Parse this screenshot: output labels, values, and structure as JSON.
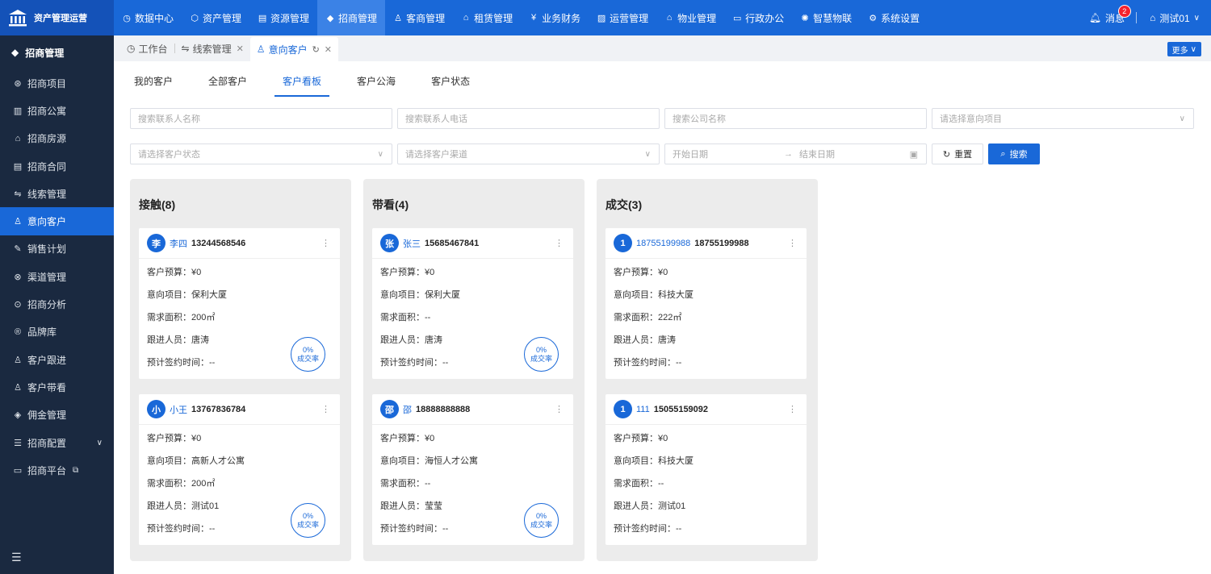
{
  "brand": {
    "title": "资产管理运营"
  },
  "nav": [
    {
      "label": "数据中心",
      "icon": "clock-icon",
      "glyph": "◷"
    },
    {
      "label": "资产管理",
      "icon": "cube-icon",
      "glyph": "⬡"
    },
    {
      "label": "资源管理",
      "icon": "building-icon",
      "glyph": "▤"
    },
    {
      "label": "招商管理",
      "icon": "tag-icon",
      "glyph": "◆"
    },
    {
      "label": "客商管理",
      "icon": "people-icon",
      "glyph": "♙"
    },
    {
      "label": "租赁管理",
      "icon": "house-icon",
      "glyph": "⌂"
    },
    {
      "label": "业务财务",
      "icon": "yen-icon",
      "glyph": "¥"
    },
    {
      "label": "运营管理",
      "icon": "chart-icon",
      "glyph": "▨"
    },
    {
      "label": "物业管理",
      "icon": "home-icon",
      "glyph": "⌂"
    },
    {
      "label": "行政办公",
      "icon": "monitor-icon",
      "glyph": "▭"
    },
    {
      "label": "智慧物联",
      "icon": "sun-icon",
      "glyph": "✺"
    },
    {
      "label": "系统设置",
      "icon": "gear-icon",
      "glyph": "⚙"
    }
  ],
  "header": {
    "messages": "消息",
    "message_count": "2",
    "user": "测试01"
  },
  "sidebar": {
    "title": "招商管理",
    "items": [
      {
        "label": "招商项目",
        "icon": "project-icon",
        "glyph": "⊛"
      },
      {
        "label": "招商公寓",
        "icon": "apartment-icon",
        "glyph": "▥"
      },
      {
        "label": "招商房源",
        "icon": "house-icon",
        "glyph": "⌂"
      },
      {
        "label": "招商合同",
        "icon": "contract-icon",
        "glyph": "▤"
      },
      {
        "label": "线索管理",
        "icon": "clue-icon",
        "glyph": "⇋"
      },
      {
        "label": "意向客户",
        "icon": "customer-icon",
        "glyph": "♙"
      },
      {
        "label": "销售计划",
        "icon": "plan-icon",
        "glyph": "✎"
      },
      {
        "label": "渠道管理",
        "icon": "channel-icon",
        "glyph": "⊗"
      },
      {
        "label": "招商分析",
        "icon": "analysis-icon",
        "glyph": "⊙"
      },
      {
        "label": "品牌库",
        "icon": "brand-icon",
        "glyph": "®"
      },
      {
        "label": "客户跟进",
        "icon": "follow-icon",
        "glyph": "♙"
      },
      {
        "label": "客户带看",
        "icon": "visit-icon",
        "glyph": "♙"
      },
      {
        "label": "佣金管理",
        "icon": "commission-icon",
        "glyph": "◈"
      },
      {
        "label": "招商配置",
        "icon": "config-icon",
        "glyph": "☰"
      },
      {
        "label": "招商平台",
        "icon": "platform-icon",
        "glyph": "▭"
      }
    ]
  },
  "tabs": [
    {
      "label": "工作台"
    },
    {
      "label": "线索管理"
    },
    {
      "label": "意向客户"
    }
  ],
  "more": "更多",
  "subtabs": [
    "我的客户",
    "全部客户",
    "客户看板",
    "客户公海",
    "客户状态"
  ],
  "filters": {
    "contact_name": "搜索联系人名称",
    "contact_phone": "搜索联系人电话",
    "company": "搜索公司名称",
    "project": "请选择意向项目",
    "status": "请选择客户状态",
    "channel": "请选择客户渠道",
    "start_date": "开始日期",
    "end_date": "结束日期",
    "reset": "重置",
    "search": "搜索"
  },
  "labels": {
    "budget": "客户预算：",
    "project": "意向项目：",
    "area": "需求面积：",
    "follower": "跟进人员：",
    "sign_time": "预计签约时间：",
    "rate_label": "成交率"
  },
  "columns": [
    {
      "title": "接触(8)",
      "cards": [
        {
          "avatar": "李",
          "name": "李四",
          "phone": "13244568546",
          "budget": "¥0",
          "project": "保利大厦",
          "area": "200㎡",
          "follower": "唐涛",
          "sign_time": "--",
          "rate": "0%"
        },
        {
          "avatar": "小",
          "name": "小王",
          "phone": "13767836784",
          "budget": "¥0",
          "project": "高新人才公寓",
          "area": "200㎡",
          "follower": "测试01",
          "sign_time": "--",
          "rate": "0%"
        }
      ]
    },
    {
      "title": "带看(4)",
      "cards": [
        {
          "avatar": "张",
          "name": "张三",
          "phone": "15685467841",
          "budget": "¥0",
          "project": "保利大厦",
          "area": "--",
          "follower": "唐涛",
          "sign_time": "--",
          "rate": "0%"
        },
        {
          "avatar": "邵",
          "name": "邵",
          "phone": "18888888888",
          "budget": "¥0",
          "project": "海恒人才公寓",
          "area": "--",
          "follower": "莹莹",
          "sign_time": "--",
          "rate": "0%"
        }
      ]
    },
    {
      "title": "成交(3)",
      "cards": [
        {
          "avatar": "1",
          "name": "18755199988",
          "phone": "18755199988",
          "budget": "¥0",
          "project": "科技大厦",
          "area": "222㎡",
          "follower": "唐涛",
          "sign_time": "--"
        },
        {
          "avatar": "1",
          "name": "111",
          "phone": "15055159092",
          "budget": "¥0",
          "project": "科技大厦",
          "area": "--",
          "follower": "测试01",
          "sign_time": "--"
        }
      ]
    }
  ]
}
